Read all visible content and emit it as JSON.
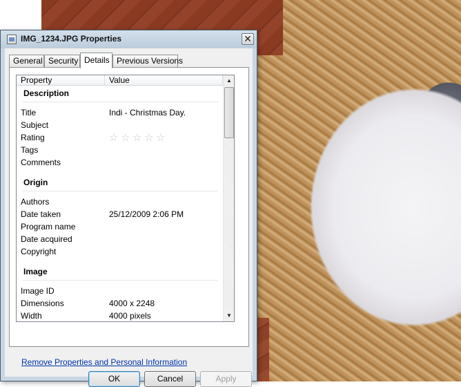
{
  "window": {
    "title": "IMG_1234.JPG Properties",
    "close_glyph": "✕"
  },
  "tabs": [
    {
      "label": "General"
    },
    {
      "label": "Security"
    },
    {
      "label": "Details",
      "active": true
    },
    {
      "label": "Previous Versions"
    }
  ],
  "list": {
    "columns": {
      "property": "Property",
      "value": "Value"
    },
    "groups": {
      "description": {
        "header": "Description",
        "rows": [
          {
            "property": "Title",
            "value": "Indi - Christmas Day."
          },
          {
            "property": "Subject",
            "value": ""
          },
          {
            "property": "Rating",
            "value": ""
          },
          {
            "property": "Tags",
            "value": ""
          },
          {
            "property": "Comments",
            "value": ""
          }
        ]
      },
      "origin": {
        "header": "Origin",
        "rows": [
          {
            "property": "Authors",
            "value": ""
          },
          {
            "property": "Date taken",
            "value": "25/12/2009 2:06 PM"
          },
          {
            "property": "Program name",
            "value": ""
          },
          {
            "property": "Date acquired",
            "value": ""
          },
          {
            "property": "Copyright",
            "value": ""
          }
        ]
      },
      "image": {
        "header": "Image",
        "rows": [
          {
            "property": "Image ID",
            "value": ""
          },
          {
            "property": "Dimensions",
            "value": "4000 x 2248"
          },
          {
            "property": "Width",
            "value": "4000 pixels"
          }
        ]
      }
    },
    "rating": {
      "stars_total": 5,
      "stars_filled": 0,
      "star_glyph": "☆"
    }
  },
  "scrollbar": {
    "up_glyph": "▲",
    "down_glyph": "▼"
  },
  "footer": {
    "remove_link": "Remove Properties and Personal Information",
    "ok_label": "OK",
    "cancel_label": "Cancel",
    "apply_label": "Apply"
  }
}
